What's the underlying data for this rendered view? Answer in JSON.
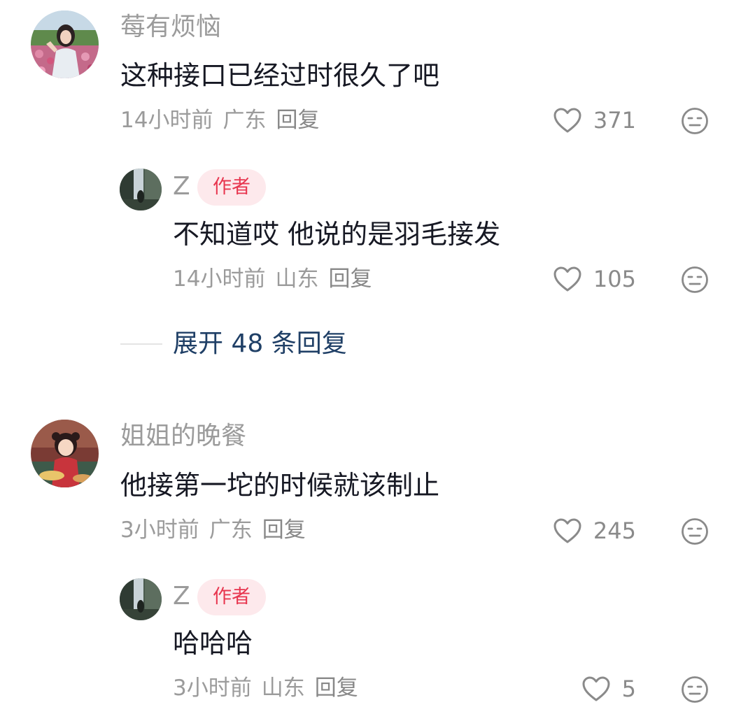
{
  "comments": [
    {
      "username": "莓有烦恼",
      "text": "这种接口已经过时很久了吧",
      "time": "14小时前",
      "location": "广东",
      "reply_label": "回复",
      "likes": "371",
      "replies": [
        {
          "username": "Z",
          "badge": "作者",
          "text": "不知道哎 他说的是羽毛接发",
          "time": "14小时前",
          "location": "山东",
          "reply_label": "回复",
          "likes": "105"
        }
      ],
      "expand_label": "展开 48 条回复"
    },
    {
      "username": "姐姐的晚餐",
      "text": "他接第一坨的时候就该制止",
      "time": "3小时前",
      "location": "广东",
      "reply_label": "回复",
      "likes": "245",
      "replies": [
        {
          "username": "Z",
          "badge": "作者",
          "text": "哈哈哈",
          "time": "3小时前",
          "location": "山东",
          "reply_label": "回复",
          "likes": "5"
        }
      ]
    }
  ],
  "colors": {
    "username": "#9b9b9b",
    "content": "#161823",
    "meta": "#9b9b9b",
    "badge_bg": "#fde9ec",
    "badge_text": "#e8364f",
    "expand_link": "#1f3f66",
    "icon_stroke": "#8a8a8a"
  },
  "icons": {
    "like": "heart-outline-icon",
    "dislike": "neutral-face-icon"
  }
}
